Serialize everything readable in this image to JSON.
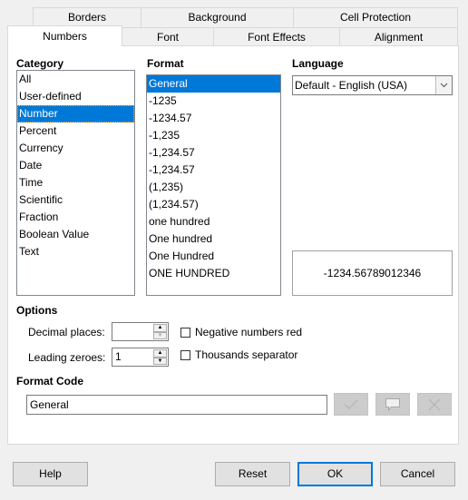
{
  "tabs": {
    "row_back": [
      {
        "label": "Borders"
      },
      {
        "label": "Background"
      },
      {
        "label": "Cell Protection"
      }
    ],
    "row_front": [
      {
        "label": "Numbers",
        "active": true
      },
      {
        "label": "Font"
      },
      {
        "label": "Font Effects"
      },
      {
        "label": "Alignment"
      }
    ]
  },
  "category": {
    "label": "Category",
    "items": [
      "All",
      "User-defined",
      "Number",
      "Percent",
      "Currency",
      "Date",
      "Time",
      "Scientific",
      "Fraction",
      "Boolean Value",
      "Text"
    ],
    "selected": "Number"
  },
  "format": {
    "label": "Format",
    "items": [
      "General",
      "-1235",
      "-1234.57",
      "-1,235",
      "-1,234.57",
      "-1,234.57",
      "(1,235)",
      "(1,234.57)",
      "one hundred",
      "One hundred",
      "One Hundred",
      "ONE HUNDRED"
    ],
    "selected": "General"
  },
  "language": {
    "label": "Language",
    "value": "Default - English (USA)"
  },
  "preview": {
    "value": "-1234.56789012346"
  },
  "options": {
    "label": "Options",
    "decimal_places_label": "Decimal places:",
    "decimal_places_value": "",
    "leading_zeroes_label": "Leading zeroes:",
    "leading_zeroes_value": "1",
    "negative_red_label": "Negative numbers red",
    "negative_red_checked": false,
    "thousands_sep_label": "Thousands separator",
    "thousands_sep_checked": false
  },
  "format_code": {
    "label": "Format Code",
    "value": "General"
  },
  "buttons": {
    "help": "Help",
    "reset": "Reset",
    "ok": "OK",
    "cancel": "Cancel"
  },
  "colors": {
    "selection": "#0078d7",
    "default_button_border": "#0078d7"
  }
}
